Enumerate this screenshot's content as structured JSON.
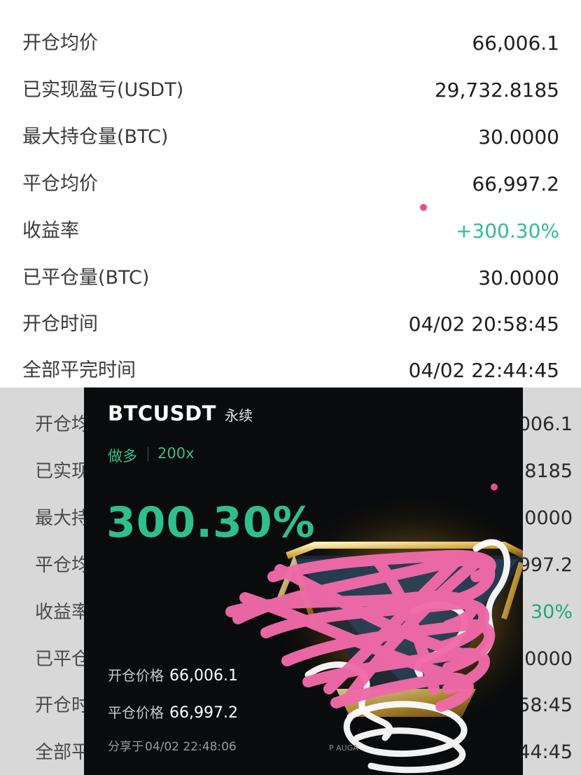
{
  "details": {
    "rows": [
      {
        "label": "开仓均价",
        "value": "66,006.1"
      },
      {
        "label": "已实现盈亏(USDT)",
        "value": "29,732.8185"
      },
      {
        "label": "最大持仓量(BTC)",
        "value": "30.0000"
      },
      {
        "label": "平仓均价",
        "value": "66,997.2"
      },
      {
        "label": "收益率",
        "value": "+300.30%"
      },
      {
        "label": "已平仓量(BTC)",
        "value": "30.0000"
      },
      {
        "label": "开仓时间",
        "value": "04/02 20:58:45"
      },
      {
        "label": "全部平完时间",
        "value": "04/02 22:44:45"
      }
    ]
  },
  "background_list": {
    "rows": [
      {
        "label": "开仓均",
        "value": "006.1"
      },
      {
        "label": "已实现",
        "value": "8185"
      },
      {
        "label": "最大持",
        "value": "0000"
      },
      {
        "label": "平仓均",
        "value": "997.2"
      },
      {
        "label": "收益率",
        "value": "30%"
      },
      {
        "label": "已平仓",
        "value": "0000"
      },
      {
        "label": "开仓时",
        "value": "58:45"
      },
      {
        "label": "全部平",
        "value": "44:45"
      }
    ]
  },
  "share_card": {
    "symbol": "BTCUSDT",
    "contract_type": "永续",
    "side": "做多",
    "leverage": "200x",
    "roe": "300.30%",
    "open_price_label": "开仓价格",
    "open_price": "66,006.1",
    "close_price_label": "平仓价格",
    "close_price": "66,997.2",
    "shared_label": "分享于",
    "shared_time": "04/02 22:48:06",
    "footer_text": "P      AUGA"
  },
  "colors": {
    "profit_green": "#2fbf8d",
    "scribble_pink": "#f06aa8",
    "card_background": "#0a0b0c",
    "overlay_gray": "#d8d8d8"
  }
}
